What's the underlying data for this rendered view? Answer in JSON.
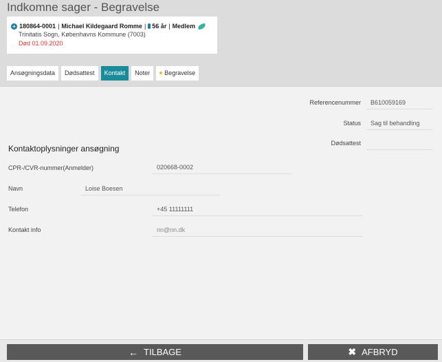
{
  "header": {
    "title": "Indkomne sager - Begravelse"
  },
  "case": {
    "id": "180864-0001",
    "name": "Michael Kildegaard Romme",
    "age": "56 år",
    "membership": "Medlem",
    "parish": "Trinitatis Sogn, Københavns Kommune (7003)",
    "death": "Død 01.09.2020",
    "sep": "|"
  },
  "tabs": [
    {
      "label": "Ansøgningsdata"
    },
    {
      "label": "Dødsattest"
    },
    {
      "label": "Kontakt"
    },
    {
      "label": "Noter"
    },
    {
      "label": "Begravelse"
    }
  ],
  "reference": {
    "ref_label": "Referencenummer",
    "ref_value": "B610059169",
    "status_label": "Status",
    "status_value": "Sag til behandling",
    "cert_label": "Dødsattest",
    "cert_value": ""
  },
  "contact": {
    "section_title": "Kontaktoplysninger ansøgning",
    "cpr_label": "CPR-/CVR-nummer(Anmelder)",
    "cpr_value": "020668-0002",
    "name_label": "Navn",
    "name_value": "Loise Boesen",
    "phone_label": "Telefon",
    "phone_value": "+45 11111111",
    "info_label": "Kontakt info",
    "info_placeholder": "nn@nn.dk"
  },
  "footer": {
    "back_label": "TILBAGE",
    "cancel_label": "AFBRYD"
  },
  "colors": {
    "accent": "#1a8b9a",
    "death_red": "#e03030",
    "button_gray": "#595959"
  }
}
